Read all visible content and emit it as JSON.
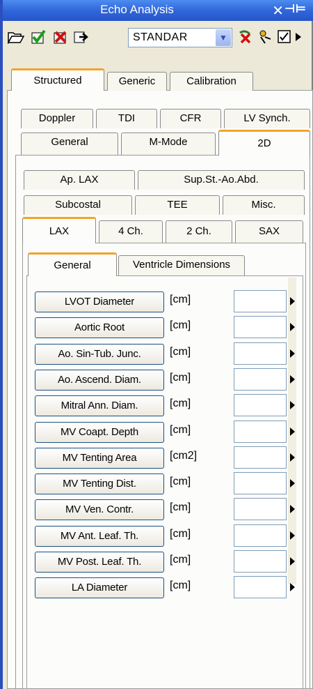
{
  "window": {
    "title": "Echo Analysis"
  },
  "toolbar": {
    "icons": [
      "open-folder-icon",
      "save-check-icon",
      "delete-icon",
      "export-icon",
      "cancel-measure-icon",
      "wizard-icon",
      "report-icon",
      "more-arrow-icon"
    ],
    "preset_value": "STANDAR"
  },
  "tabs": {
    "top": [
      "Structured",
      "Generic",
      "Calibration"
    ],
    "modality_row1": [
      "Doppler",
      "TDI",
      "CFR",
      "LV Synch."
    ],
    "modality_row2": [
      "General",
      "M-Mode",
      "2D"
    ],
    "view_row1": [
      "Ap. LAX",
      "Sup.St.-Ao.Abd."
    ],
    "view_row2": [
      "Subcostal",
      "TEE",
      "Misc."
    ],
    "view_row3": [
      "LAX",
      "4 Ch.",
      "2 Ch.",
      "SAX"
    ],
    "section": [
      "General",
      "Ventricle Dimensions"
    ]
  },
  "measurements": [
    {
      "label": "LVOT Diameter",
      "unit": "[cm]"
    },
    {
      "label": "Aortic Root",
      "unit": "[cm]"
    },
    {
      "label": "Ao. Sin-Tub. Junc.",
      "unit": "[cm]"
    },
    {
      "label": "Ao. Ascend. Diam.",
      "unit": "[cm]"
    },
    {
      "label": "Mitral Ann. Diam.",
      "unit": "[cm]"
    },
    {
      "label": "MV Coapt. Depth",
      "unit": "[cm]"
    },
    {
      "label": "MV Tenting Area",
      "unit": "[cm2]"
    },
    {
      "label": "MV Tenting Dist.",
      "unit": "[cm]"
    },
    {
      "label": "MV Ven. Contr.",
      "unit": "[cm]"
    },
    {
      "label": "MV Ant. Leaf. Th.",
      "unit": "[cm]"
    },
    {
      "label": "MV Post. Leaf. Th.",
      "unit": "[cm]"
    },
    {
      "label": "LA Diameter",
      "unit": "[cm]"
    }
  ]
}
